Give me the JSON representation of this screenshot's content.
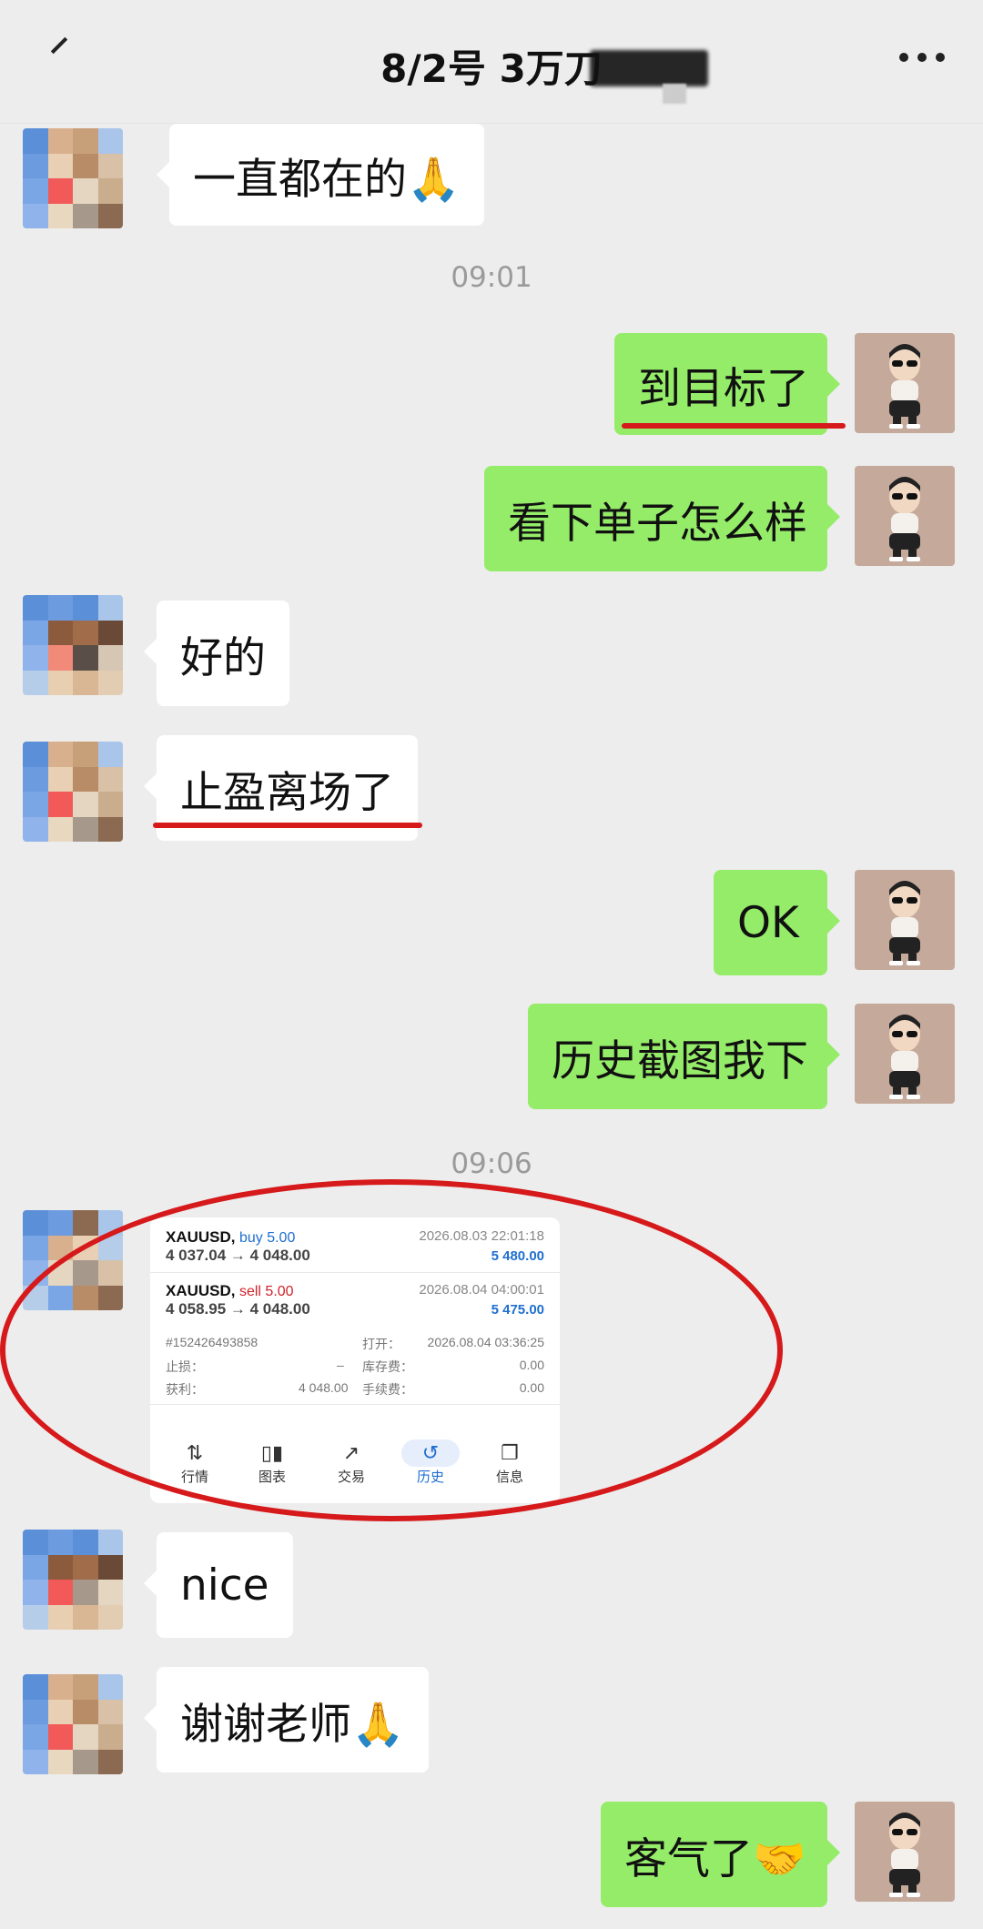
{
  "header": {
    "title": "8/2号  3万刀"
  },
  "messages": {
    "m1": "一直都在的🙏",
    "m2": "到目标了",
    "m3": "看下单子怎么样",
    "m4": "好的",
    "m5": "止盈离场了",
    "m6": "OK",
    "m7": "历史截图我下",
    "m8": "nice",
    "m9": "谢谢老师🙏",
    "m10": "客气了🤝"
  },
  "timestamps": {
    "t1": "09:01",
    "t2": "09:06"
  },
  "screenshot": {
    "trade1": {
      "symbol": "XAUUSD,",
      "side": "buy 5.00",
      "prices": "4 037.04 → 4 048.00",
      "datetime": "2026.08.03 22:01:18",
      "profit": "5 480.00"
    },
    "trade2": {
      "symbol": "XAUUSD,",
      "side": "sell 5.00",
      "prices": "4 058.95 → 4 048.00",
      "datetime": "2026.08.04 04:00:01",
      "profit": "5 475.00"
    },
    "details": {
      "order_id": "#152426493858",
      "open_label": "打开：",
      "open_value": "2026.08.04 03:36:25",
      "sl_label": "止损：",
      "sl_value": "–",
      "swap_label": "库存费：",
      "swap_value": "0.00",
      "tp_label": "获利：",
      "tp_value": "4 048.00",
      "fee_label": "手续费：",
      "fee_value": "0.00"
    },
    "tabs": [
      "行情",
      "图表",
      "交易",
      "历史",
      "信息"
    ],
    "active_tab": "历史"
  },
  "colors": {
    "outgoing_bubble": "#95ec69",
    "incoming_bubble": "#ffffff",
    "annotation_red": "#d6191b",
    "background": "#ededed"
  }
}
